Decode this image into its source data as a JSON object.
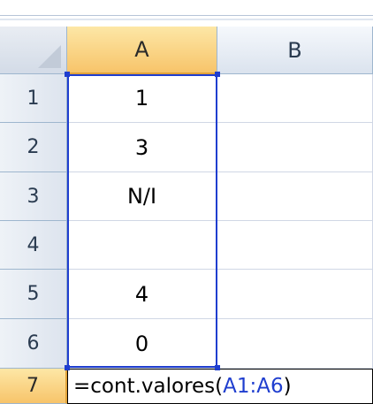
{
  "columns": [
    "A",
    "B"
  ],
  "rows": [
    {
      "num": "1",
      "a": "1"
    },
    {
      "num": "2",
      "a": "3"
    },
    {
      "num": "3",
      "a": "N/I"
    },
    {
      "num": "4",
      "a": ""
    },
    {
      "num": "5",
      "a": "4"
    },
    {
      "num": "6",
      "a": "0"
    },
    {
      "num": "7",
      "a": ""
    }
  ],
  "formula": {
    "prefix": "=cont.valores(",
    "range": "A1:A6",
    "suffix": ")"
  }
}
